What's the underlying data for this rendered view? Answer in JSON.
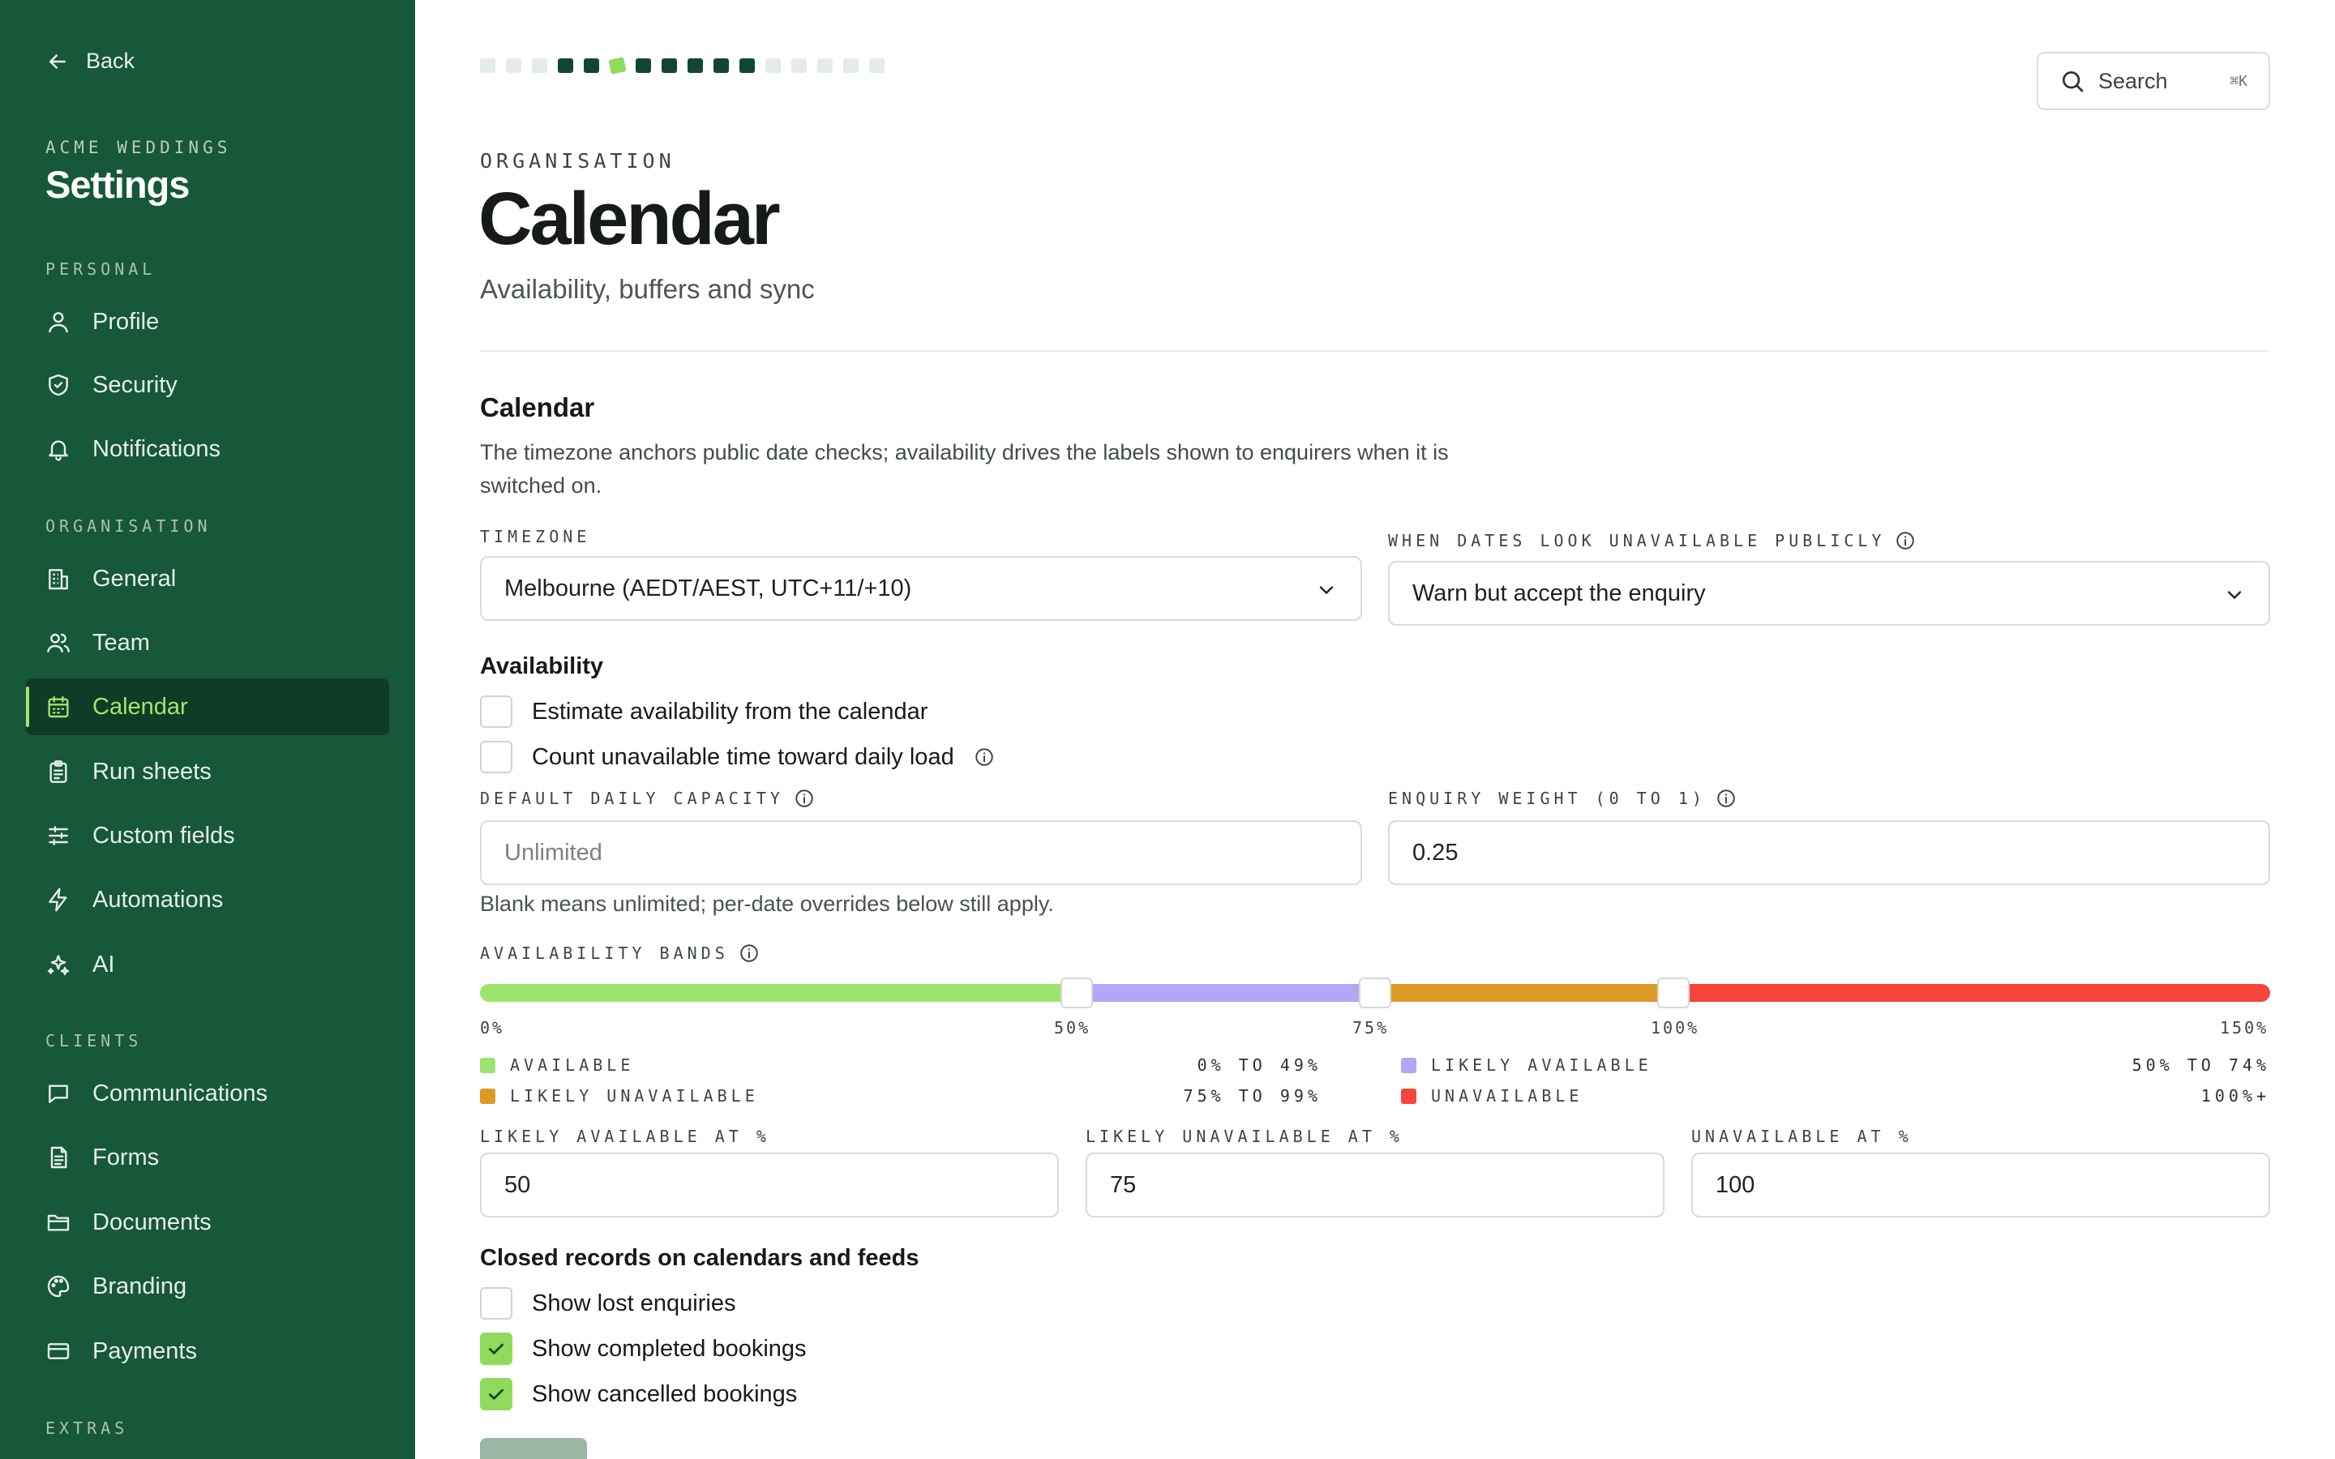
{
  "sidebar": {
    "back_label": "Back",
    "org_name": "ACME WEDDINGS",
    "title": "Settings",
    "sections": [
      {
        "label": "PERSONAL",
        "items": [
          {
            "label": "Profile",
            "icon": "user-icon"
          },
          {
            "label": "Security",
            "icon": "shield-icon"
          },
          {
            "label": "Notifications",
            "icon": "bell-icon"
          }
        ]
      },
      {
        "label": "ORGANISATION",
        "items": [
          {
            "label": "General",
            "icon": "building-icon"
          },
          {
            "label": "Team",
            "icon": "users-icon"
          },
          {
            "label": "Calendar",
            "icon": "calendar-icon",
            "active": true
          },
          {
            "label": "Run sheets",
            "icon": "clipboard-icon"
          },
          {
            "label": "Custom fields",
            "icon": "sliders-icon"
          },
          {
            "label": "Automations",
            "icon": "bolt-icon"
          },
          {
            "label": "AI",
            "icon": "sparkles-icon"
          }
        ]
      },
      {
        "label": "CLIENTS",
        "items": [
          {
            "label": "Communications",
            "icon": "message-icon"
          },
          {
            "label": "Forms",
            "icon": "form-icon"
          },
          {
            "label": "Documents",
            "icon": "folder-icon"
          },
          {
            "label": "Branding",
            "icon": "palette-icon"
          },
          {
            "label": "Payments",
            "icon": "card-icon"
          }
        ]
      },
      {
        "label": "EXTRAS",
        "items": []
      }
    ]
  },
  "header": {
    "search_label": "Search",
    "search_shortcut": "⌘K",
    "eyebrow": "ORGANISATION",
    "title": "Calendar",
    "subtitle": "Availability, buffers and sync"
  },
  "calendar": {
    "heading": "Calendar",
    "description": "The timezone anchors public date checks; availability drives the labels shown to enquirers when it is switched on.",
    "timezone": {
      "label": "TIMEZONE",
      "value": "Melbourne (AEDT/AEST, UTC+11/+10)"
    },
    "unavailable_behaviour": {
      "label": "WHEN DATES LOOK UNAVAILABLE PUBLICLY",
      "value": "Warn but accept the enquiry"
    },
    "availability_heading": "Availability",
    "availability_options": [
      {
        "label": "Estimate availability from the calendar",
        "checked": false
      },
      {
        "label": "Count unavailable time toward daily load",
        "checked": false
      }
    ],
    "capacity": {
      "label": "DEFAULT DAILY CAPACITY",
      "value": "",
      "placeholder": "Unlimited"
    },
    "enquiry_weight": {
      "label": "ENQUIRY WEIGHT (0 TO 1)",
      "value": "0.25"
    },
    "capacity_hint": "Blank means unlimited; per-date overrides below still apply.",
    "bands": {
      "label": "AVAILABILITY BANDS",
      "max_percent": 150,
      "ticks": [
        "0%",
        "50%",
        "75%",
        "100%",
        "150%"
      ],
      "thresholds": [
        50,
        75,
        100
      ],
      "colors": {
        "available": "#9ee36e",
        "likely_available": "#b3a7f5",
        "likely_unavailable": "#dd9a25",
        "unavailable": "#f7453a"
      },
      "legend": [
        {
          "label": "AVAILABLE",
          "range": "0% TO 49%",
          "color": "#9ee36e"
        },
        {
          "label": "LIKELY AVAILABLE",
          "range": "50% TO 74%",
          "color": "#b3a7f5"
        },
        {
          "label": "LIKELY UNAVAILABLE",
          "range": "75% TO 99%",
          "color": "#dd9a25"
        },
        {
          "label": "UNAVAILABLE",
          "range": "100%+",
          "color": "#f7453a"
        }
      ]
    },
    "threshold_inputs": [
      {
        "label": "LIKELY AVAILABLE AT %",
        "value": "50"
      },
      {
        "label": "LIKELY UNAVAILABLE AT %",
        "value": "75"
      },
      {
        "label": "UNAVAILABLE AT %",
        "value": "100"
      }
    ],
    "closed_heading": "Closed records on calendars and feeds",
    "closed_options": [
      {
        "label": "Show lost enquiries",
        "checked": false
      },
      {
        "label": "Show completed bookings",
        "checked": true
      },
      {
        "label": "Show cancelled bookings",
        "checked": true
      }
    ]
  },
  "progress": {
    "total": 16,
    "completed": 7,
    "current": 2
  }
}
